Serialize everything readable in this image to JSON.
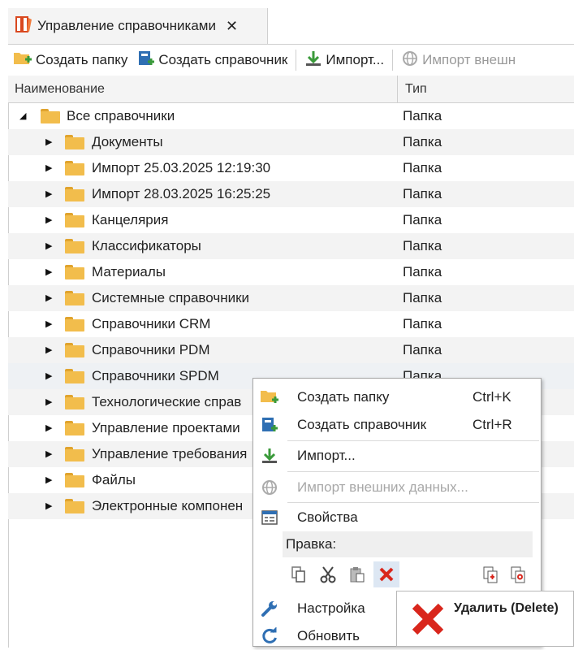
{
  "tab": {
    "title": "Управление справочниками",
    "close": "✕"
  },
  "toolbar": {
    "create_folder": "Создать папку",
    "create_reference": "Создать справочник",
    "import": "Импорт...",
    "import_external": "Импорт внешн"
  },
  "columns": {
    "name": "Наименование",
    "type": "Тип"
  },
  "tree": {
    "root": {
      "label": "Все справочники",
      "type": "Папка"
    },
    "items": [
      {
        "label": "Документы",
        "type": "Папка"
      },
      {
        "label": "Импорт 25.03.2025 12:19:30",
        "type": "Папка"
      },
      {
        "label": "Импорт 28.03.2025 16:25:25",
        "type": "Папка"
      },
      {
        "label": "Канцелярия",
        "type": "Папка"
      },
      {
        "label": "Классификаторы",
        "type": "Папка"
      },
      {
        "label": "Материалы",
        "type": "Папка"
      },
      {
        "label": "Системные справочники",
        "type": "Папка"
      },
      {
        "label": "Справочники CRM",
        "type": "Папка"
      },
      {
        "label": "Справочники PDM",
        "type": "Папка"
      },
      {
        "label": "Справочники SPDM",
        "type": "Папка"
      },
      {
        "label": "Технологические справ",
        "type": ""
      },
      {
        "label": "Управление проектами",
        "type": ""
      },
      {
        "label": "Управление требования",
        "type": ""
      },
      {
        "label": "Файлы",
        "type": ""
      },
      {
        "label": "Электронные компонен",
        "type": ""
      }
    ]
  },
  "context_menu": {
    "create_folder": {
      "label": "Создать папку",
      "shortcut": "Ctrl+K"
    },
    "create_reference": {
      "label": "Создать справочник",
      "shortcut": "Ctrl+R"
    },
    "import": {
      "label": "Импорт..."
    },
    "import_external": {
      "label": "Импорт внешних данных..."
    },
    "properties": {
      "label": "Свойства"
    },
    "edit_section": "Правка:",
    "settings": {
      "label": "Настройка"
    },
    "refresh": {
      "label": "Обновить"
    }
  },
  "tooltip": {
    "text": "Удалить (Delete)"
  },
  "colors": {
    "folder": "#f2bd4c",
    "delete_red": "#d9261c",
    "accent_blue": "#2f6fb3",
    "green": "#3a9a3a"
  }
}
